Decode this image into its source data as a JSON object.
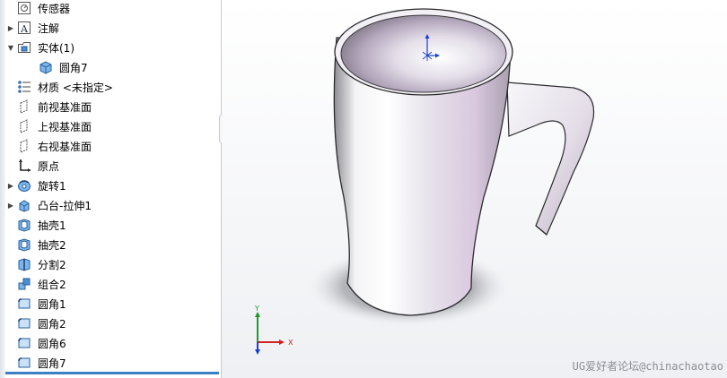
{
  "feature_tree": {
    "items": [
      {
        "label": "传感器",
        "icon": "sensor-icon",
        "arrow": ""
      },
      {
        "label": "注解",
        "icon": "annotation-icon",
        "arrow": "right"
      },
      {
        "label": "实体(1)",
        "icon": "solid-bodies-folder-icon",
        "arrow": "down"
      },
      {
        "label": "圆角7",
        "icon": "solid-body-icon",
        "arrow": ""
      },
      {
        "label": "材质 <未指定>",
        "icon": "material-icon",
        "arrow": ""
      },
      {
        "label": "前视基准面",
        "icon": "plane-icon",
        "arrow": ""
      },
      {
        "label": "上视基准面",
        "icon": "plane-icon",
        "arrow": ""
      },
      {
        "label": "右视基准面",
        "icon": "plane-icon",
        "arrow": ""
      },
      {
        "label": "原点",
        "icon": "origin-icon",
        "arrow": ""
      },
      {
        "label": "旋转1",
        "icon": "revolve-icon",
        "arrow": "right"
      },
      {
        "label": "凸台-拉伸1",
        "icon": "extrude-icon",
        "arrow": "right"
      },
      {
        "label": "抽壳1",
        "icon": "shell-icon",
        "arrow": ""
      },
      {
        "label": "抽壳2",
        "icon": "shell-icon",
        "arrow": ""
      },
      {
        "label": "分割2",
        "icon": "split-icon",
        "arrow": ""
      },
      {
        "label": "组合2",
        "icon": "combine-icon",
        "arrow": ""
      },
      {
        "label": "圆角1",
        "icon": "fillet-icon",
        "arrow": ""
      },
      {
        "label": "圆角2",
        "icon": "fillet-icon",
        "arrow": ""
      },
      {
        "label": "圆角6",
        "icon": "fillet-icon",
        "arrow": ""
      },
      {
        "label": "圆角7",
        "icon": "fillet-icon",
        "arrow": ""
      }
    ]
  },
  "viewport": {
    "triad": {
      "x_label": "X",
      "y_label": "Y"
    },
    "watermark": "UG爱好者论坛@chinachaotao"
  },
  "colors": {
    "accent": "#3c7fc4",
    "triad_x": "#d42020",
    "triad_y": "#1f9a2e",
    "triad_z": "#1a3fd1"
  }
}
